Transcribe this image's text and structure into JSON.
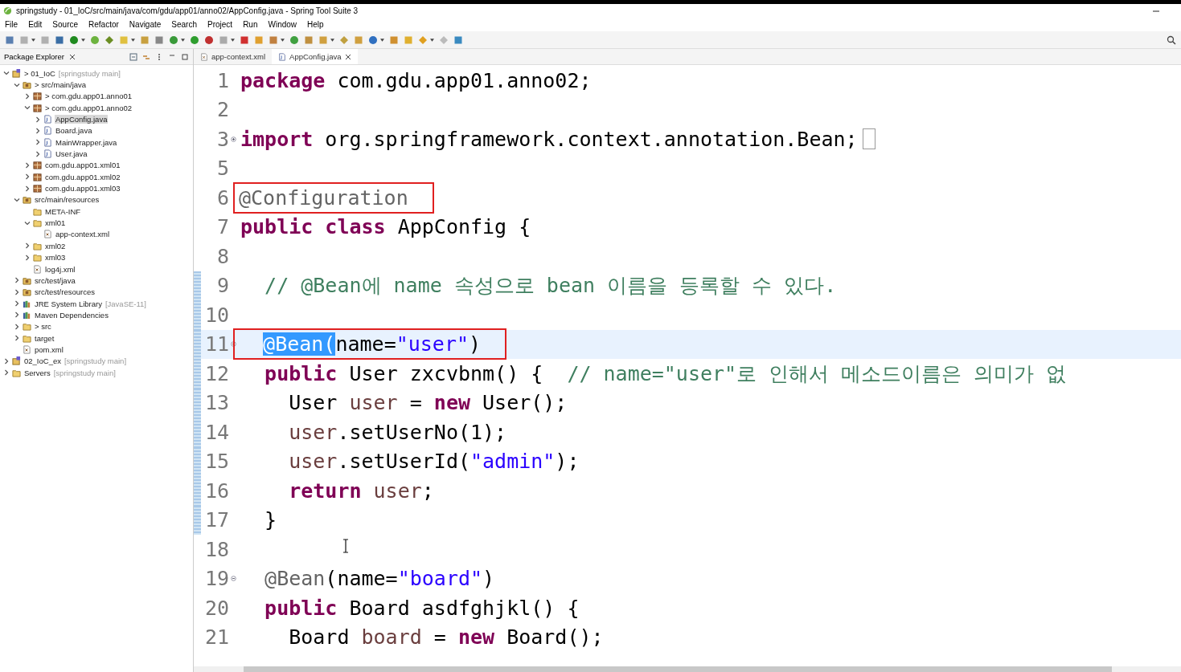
{
  "window": {
    "title": "springstudy - 01_IoC/src/main/java/com/gdu/app01/anno02/AppConfig.java - Spring Tool Suite 3"
  },
  "menu": [
    "File",
    "Edit",
    "Source",
    "Refactor",
    "Navigate",
    "Search",
    "Project",
    "Run",
    "Window",
    "Help"
  ],
  "explorer": {
    "title": "Package Explorer",
    "tree": [
      {
        "label": "> 01_IoC",
        "detail": "[springstudy main]",
        "kind": "project",
        "expanded": true,
        "selected": false,
        "children": [
          {
            "label": "> src/main/java",
            "kind": "srcfolder",
            "expanded": true,
            "selected": false,
            "children": [
              {
                "label": "> com.gdu.app01.anno01",
                "kind": "package",
                "expanded": false,
                "selected": false
              },
              {
                "label": "> com.gdu.app01.anno02",
                "kind": "package",
                "expanded": true,
                "selected": false,
                "children": [
                  {
                    "label": "AppConfig.java",
                    "kind": "java",
                    "expanded": false,
                    "selected": true
                  },
                  {
                    "label": "Board.java",
                    "kind": "java",
                    "expanded": false,
                    "selected": false
                  },
                  {
                    "label": "MainWrapper.java",
                    "kind": "java",
                    "expanded": false,
                    "selected": false
                  },
                  {
                    "label": "User.java",
                    "kind": "java",
                    "expanded": false,
                    "selected": false
                  }
                ]
              },
              {
                "label": "com.gdu.app01.xml01",
                "kind": "package",
                "expanded": false,
                "selected": false
              },
              {
                "label": "com.gdu.app01.xml02",
                "kind": "package",
                "expanded": false,
                "selected": false
              },
              {
                "label": "com.gdu.app01.xml03",
                "kind": "package",
                "expanded": false,
                "selected": false
              }
            ]
          },
          {
            "label": "src/main/resources",
            "kind": "srcfolder",
            "expanded": true,
            "selected": false,
            "children": [
              {
                "label": "META-INF",
                "kind": "folder",
                "selected": false
              },
              {
                "label": "xml01",
                "kind": "folder",
                "expanded": true,
                "selected": false,
                "children": [
                  {
                    "label": "app-context.xml",
                    "kind": "xml",
                    "selected": false
                  }
                ]
              },
              {
                "label": "xml02",
                "kind": "folder",
                "expanded": false,
                "selected": false
              },
              {
                "label": "xml03",
                "kind": "folder",
                "expanded": false,
                "selected": false
              },
              {
                "label": "log4j.xml",
                "kind": "xml",
                "selected": false
              }
            ]
          },
          {
            "label": "src/test/java",
            "kind": "srcfolder",
            "expanded": false,
            "selected": false
          },
          {
            "label": "src/test/resources",
            "kind": "srcfolder",
            "expanded": false,
            "selected": false
          },
          {
            "label": "JRE System Library",
            "detail": "[JavaSE-11]",
            "kind": "library",
            "expanded": false,
            "selected": false
          },
          {
            "label": "Maven Dependencies",
            "kind": "library",
            "expanded": false,
            "selected": false
          },
          {
            "label": "> src",
            "kind": "folder",
            "expanded": false,
            "selected": false
          },
          {
            "label": "target",
            "kind": "folder",
            "expanded": false,
            "selected": false
          },
          {
            "label": "pom.xml",
            "kind": "xml",
            "selected": false
          }
        ]
      },
      {
        "label": "02_IoC_ex",
        "detail": "[springstudy main]",
        "kind": "project",
        "expanded": false,
        "selected": false
      },
      {
        "label": "Servers",
        "detail": "[springstudy main]",
        "kind": "folder",
        "expanded": false,
        "selected": false
      }
    ]
  },
  "editor_tabs": [
    {
      "label": "app-context.xml",
      "kind": "xml",
      "selected": false
    },
    {
      "label": "AppConfig.java",
      "kind": "java",
      "selected": true
    }
  ],
  "code": [
    {
      "number": "1",
      "tokens": [
        {
          "kind": "kw",
          "text": "package"
        },
        {
          "kind": "plain",
          "text": " com.gdu.app01.anno02;"
        }
      ]
    },
    {
      "number": "2"
    },
    {
      "number": "3",
      "foldable": true,
      "collapsed": true,
      "tokens": [
        {
          "kind": "kw",
          "text": "import"
        },
        {
          "kind": "plain",
          "text": " org.springframework.context.annotation.Bean;"
        }
      ]
    },
    {
      "number": "5"
    },
    {
      "number": "6",
      "boxed": true,
      "tokens": [
        {
          "kind": "ann",
          "text": "@Configuration"
        }
      ]
    },
    {
      "number": "7",
      "tokens": [
        {
          "kind": "kw",
          "text": "public class"
        },
        {
          "kind": "plain",
          "text": " AppConfig {"
        }
      ]
    },
    {
      "number": "8"
    },
    {
      "number": "9",
      "changed": true,
      "tokens": [
        {
          "kind": "comment",
          "text": "  // @Bean에 name 속성으로 bean 이름을 등록할 수 있다."
        }
      ]
    },
    {
      "number": "10",
      "changed": true
    },
    {
      "number": "11",
      "changed": true,
      "current": true,
      "foldable": true,
      "collapsed": false,
      "boxed": true,
      "tokens": [
        {
          "kind": "selection",
          "text": "  @Bean("
        },
        {
          "kind": "plain",
          "text": "name="
        },
        {
          "kind": "str",
          "text": "\"user\""
        },
        {
          "kind": "plain",
          "text": ")"
        }
      ]
    },
    {
      "number": "12",
      "changed": true,
      "tokens": [
        {
          "kind": "kw",
          "text": "  public"
        },
        {
          "kind": "plain",
          "text": " User zxcvbnm() {  "
        },
        {
          "kind": "comment",
          "text": "// name=\"user\"로 인해서 메소드이름은 의미가 없"
        }
      ]
    },
    {
      "number": "13",
      "changed": true,
      "tokens": [
        {
          "kind": "plain",
          "text": "    User "
        },
        {
          "kind": "var",
          "text": "user"
        },
        {
          "kind": "plain",
          "text": " = "
        },
        {
          "kind": "kw",
          "text": "new"
        },
        {
          "kind": "plain",
          "text": " User();"
        }
      ]
    },
    {
      "number": "14",
      "changed": true,
      "tokens": [
        {
          "kind": "var",
          "text": "    user"
        },
        {
          "kind": "plain",
          "text": ".setUserNo(1);"
        }
      ]
    },
    {
      "number": "15",
      "changed": true,
      "tokens": [
        {
          "kind": "var",
          "text": "    user"
        },
        {
          "kind": "plain",
          "text": ".setUserId("
        },
        {
          "kind": "str",
          "text": "\"admin\""
        },
        {
          "kind": "plain",
          "text": ");"
        }
      ]
    },
    {
      "number": "16",
      "changed": true,
      "tokens": [
        {
          "kind": "kw",
          "text": "    return"
        },
        {
          "kind": "var",
          "text": " user"
        },
        {
          "kind": "plain",
          "text": ";"
        }
      ]
    },
    {
      "number": "17",
      "changed": true,
      "tokens": [
        {
          "kind": "plain",
          "text": "  }"
        }
      ]
    },
    {
      "number": "18"
    },
    {
      "number": "19",
      "foldable": true,
      "collapsed": false,
      "tokens": [
        {
          "kind": "ann",
          "text": "  @Bean"
        },
        {
          "kind": "plain",
          "text": "(name="
        },
        {
          "kind": "str",
          "text": "\"board\""
        },
        {
          "kind": "plain",
          "text": ")"
        }
      ]
    },
    {
      "number": "20",
      "tokens": [
        {
          "kind": "kw",
          "text": "  public"
        },
        {
          "kind": "plain",
          "text": " Board asdfghjkl() {"
        }
      ]
    },
    {
      "number": "21",
      "tokens": [
        {
          "kind": "plain",
          "text": "    Board "
        },
        {
          "kind": "var",
          "text": "board"
        },
        {
          "kind": "plain",
          "text": " = "
        },
        {
          "kind": "kw",
          "text": "new"
        },
        {
          "kind": "plain",
          "text": " Board();"
        }
      ]
    }
  ]
}
